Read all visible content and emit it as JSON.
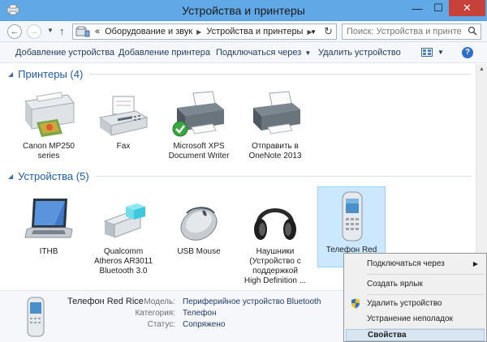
{
  "window": {
    "title": "Устройства и принтеры",
    "min_glyph": "—",
    "max_glyph": "☐",
    "close_glyph": "✕"
  },
  "address": {
    "back_glyph": "←",
    "forward_glyph": "→",
    "up_glyph": "↑",
    "crumb_prefix": "«",
    "crumbs": [
      "Оборудование и звук",
      "Устройства и принтеры"
    ],
    "crumb_sep": "▶",
    "refresh_glyph": "↻",
    "search_placeholder": "Поиск: Устройства и принте..."
  },
  "toolbar": {
    "add_device": "Добавление устройства",
    "add_printer": "Добавление принтера",
    "connect_via": "Подключаться через",
    "remove_device": "Удалить устройство",
    "help": "?"
  },
  "printers": {
    "title": "Принтеры (4)",
    "items": [
      {
        "label_lines": [
          "Canon MP250",
          "series"
        ],
        "icon": "printer-photo-icon"
      },
      {
        "label_lines": [
          "Fax"
        ],
        "icon": "fax-icon"
      },
      {
        "label_lines": [
          "Microsoft XPS",
          "Document Writer"
        ],
        "icon": "printer-default-icon"
      },
      {
        "label_lines": [
          "Отправить в",
          "OneNote 2013"
        ],
        "icon": "printer-icon"
      }
    ]
  },
  "devices": {
    "title": "Устройства (5)",
    "items": [
      {
        "label_lines": [
          "ITHB"
        ],
        "icon": "laptop-icon"
      },
      {
        "label_lines": [
          "Qualcomm",
          "Atheros AR3011",
          "Bluetooth 3.0"
        ],
        "icon": "bluetooth-adapter-icon"
      },
      {
        "label_lines": [
          "USB Mouse"
        ],
        "icon": "mouse-icon"
      },
      {
        "label_lines": [
          "Наушники",
          "(Устройство с",
          "поддержкой",
          "High Definition ..."
        ],
        "icon": "headphones-icon"
      },
      {
        "label_lines": [
          "Телефон Red"
        ],
        "icon": "phone-icon"
      }
    ]
  },
  "details": {
    "name": "Телефон Red Rice",
    "model_label": "Модель:",
    "model_value": "Периферийное устройство Bluetooth",
    "category_label": "Категория:",
    "category_value": "Телефон",
    "status_label": "Статус:",
    "status_value": "Сопряжено"
  },
  "context_menu": {
    "connect_via": "Подключаться через",
    "create_shortcut": "Создать ярлык",
    "remove_device": "Удалить устройство",
    "troubleshoot": "Устранение неполадок",
    "properties": "Свойства",
    "submenu_glyph": "▶"
  },
  "colors": {
    "titlebar": "#60a8e6",
    "close_button": "#c7413a",
    "group_header": "#1e5aa8",
    "selection": "#cce8ff"
  }
}
